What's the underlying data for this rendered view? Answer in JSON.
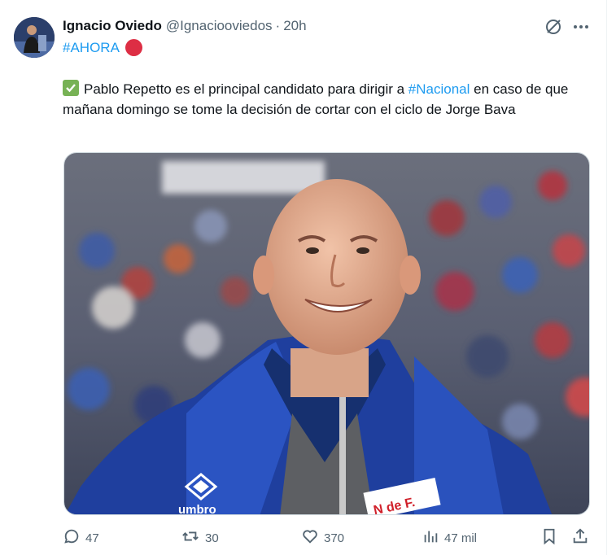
{
  "tweet": {
    "author_name": "Ignacio Oviedo",
    "handle": "@Ignaciooviedos",
    "separator": "·",
    "time": "20h",
    "hashtag_line": "#AHORA",
    "body_prefix": "Pablo Repetto es el principal candidato para dirigir a ",
    "body_hashtag": "#Nacional",
    "body_suffix": " en caso de que mañana domingo se tome la decisión de cortar con el ciclo de Jorge Bava"
  },
  "image": {
    "brand_text": "umbro",
    "badge_text": "N de F."
  },
  "actions": {
    "replies": "47",
    "reposts": "30",
    "likes": "370",
    "views": "47 mil"
  },
  "colors": {
    "link": "#1d9bf0",
    "muted": "#536471",
    "red_dot": "#dd2e44",
    "check": "#77b255"
  },
  "icons": [
    "grok-icon",
    "more-icon",
    "reply-icon",
    "repost-icon",
    "like-icon",
    "views-icon",
    "bookmark-icon",
    "share-icon"
  ]
}
